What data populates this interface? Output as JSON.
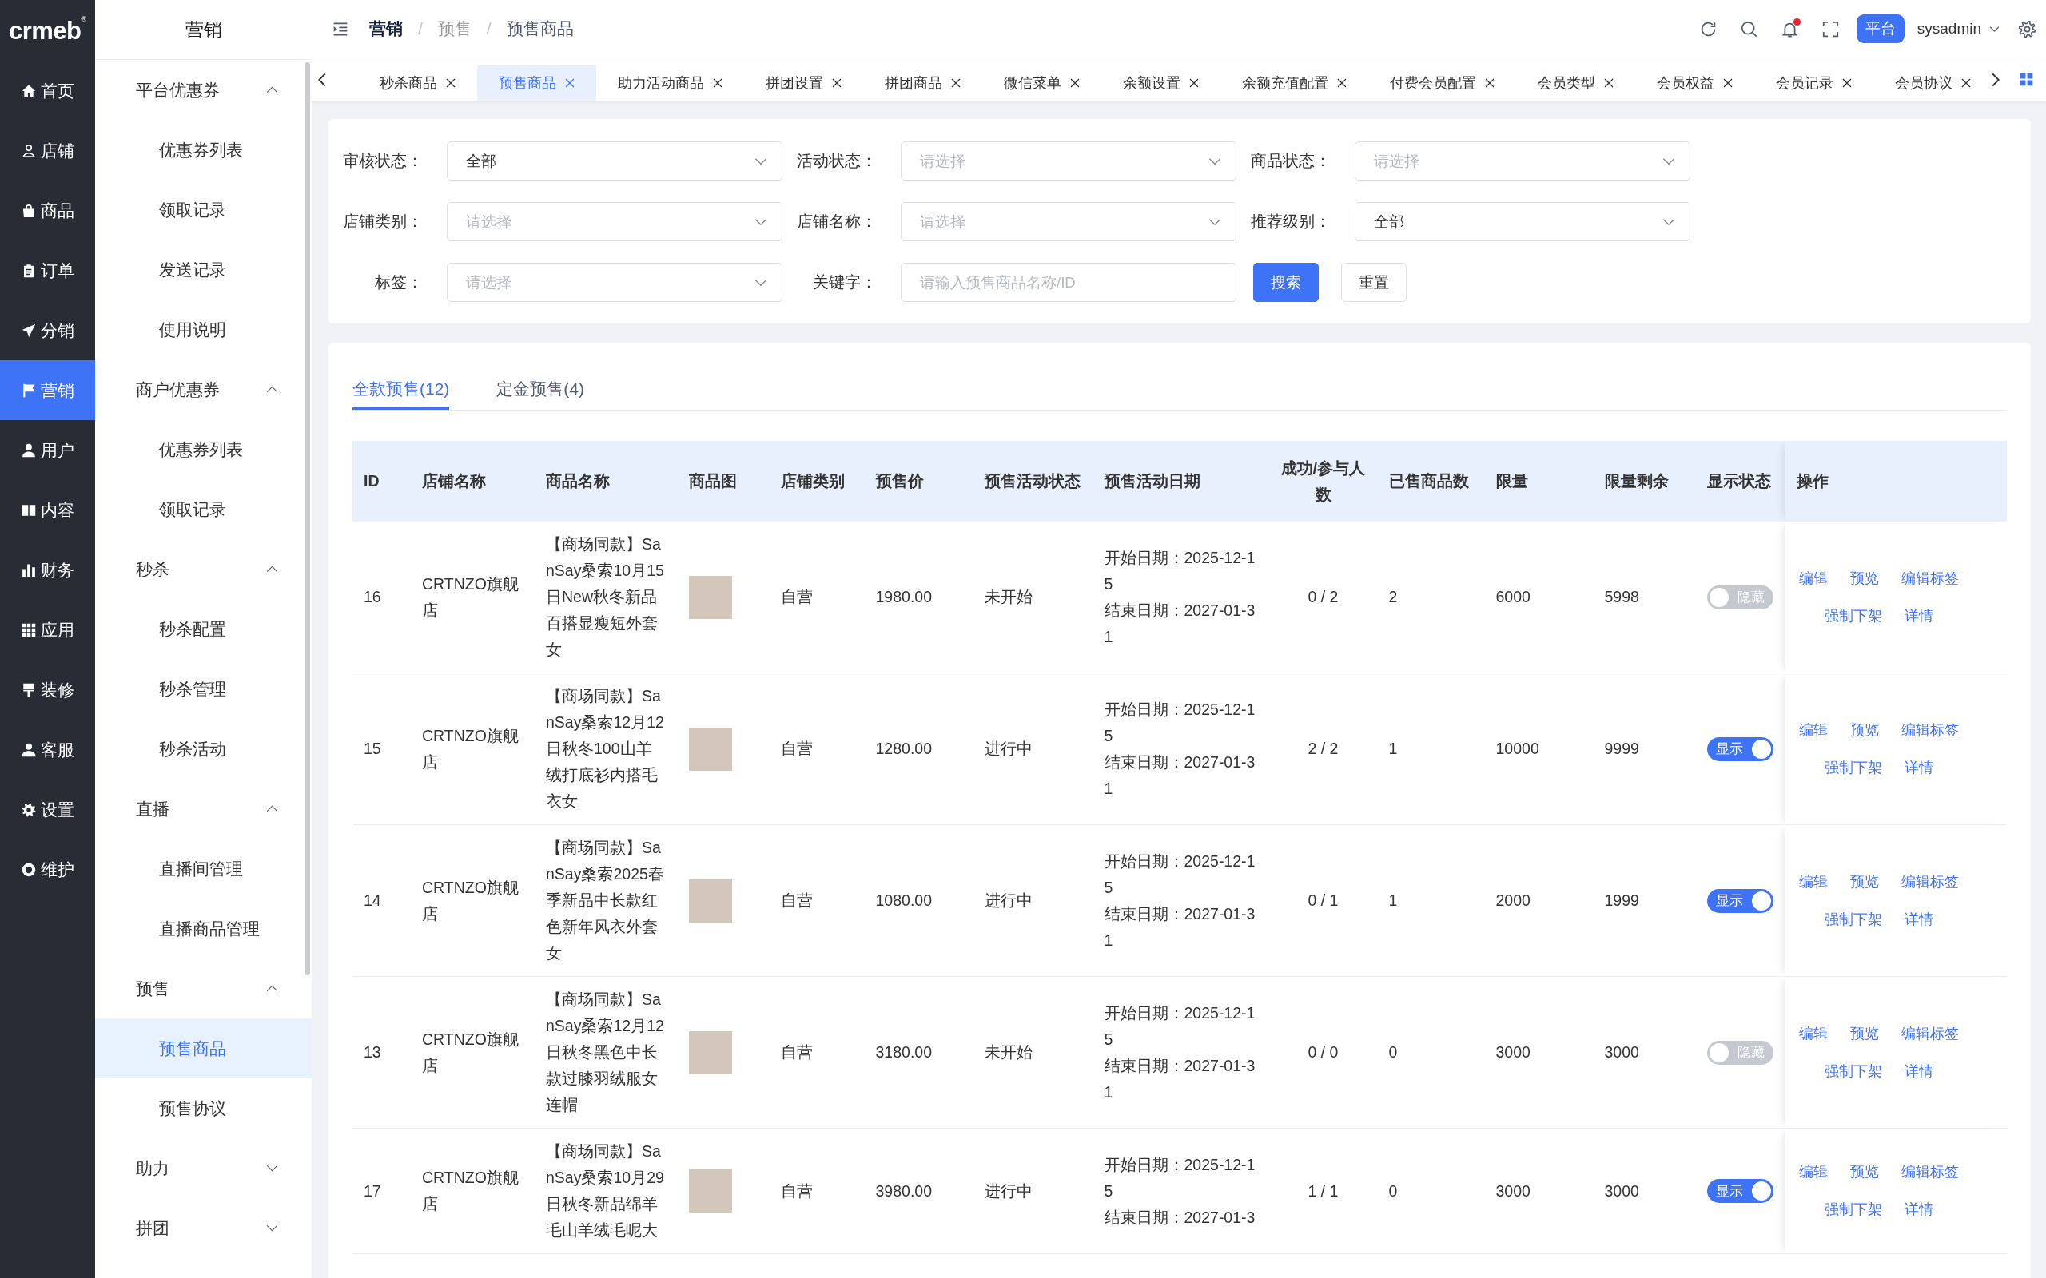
{
  "logo": {
    "text": "crmeb",
    "mark": "®"
  },
  "main_nav": {
    "items": [
      {
        "label": "首页",
        "selected": false
      },
      {
        "label": "店铺",
        "selected": false
      },
      {
        "label": "商品",
        "selected": false
      },
      {
        "label": "订单",
        "selected": false
      },
      {
        "label": "分销",
        "selected": false
      },
      {
        "label": "营销",
        "selected": true
      },
      {
        "label": "用户",
        "selected": false
      },
      {
        "label": "内容",
        "selected": false
      },
      {
        "label": "财务",
        "selected": false
      },
      {
        "label": "应用",
        "selected": false
      },
      {
        "label": "装修",
        "selected": false
      },
      {
        "label": "客服",
        "selected": false
      },
      {
        "label": "设置",
        "selected": false
      },
      {
        "label": "维护",
        "selected": false
      }
    ]
  },
  "sub_nav": {
    "title": "营销",
    "groups": [
      {
        "label": "平台优惠券",
        "expanded": true,
        "children": [
          {
            "label": "优惠券列表",
            "selected": false
          },
          {
            "label": "领取记录",
            "selected": false
          },
          {
            "label": "发送记录",
            "selected": false
          },
          {
            "label": "使用说明",
            "selected": false
          }
        ]
      },
      {
        "label": "商户优惠券",
        "expanded": true,
        "children": [
          {
            "label": "优惠券列表",
            "selected": false
          },
          {
            "label": "领取记录",
            "selected": false
          }
        ]
      },
      {
        "label": "秒杀",
        "expanded": true,
        "children": [
          {
            "label": "秒杀配置",
            "selected": false
          },
          {
            "label": "秒杀管理",
            "selected": false
          },
          {
            "label": "秒杀活动",
            "selected": false
          }
        ]
      },
      {
        "label": "直播",
        "expanded": true,
        "children": [
          {
            "label": "直播间管理",
            "selected": false
          },
          {
            "label": "直播商品管理",
            "selected": false
          }
        ]
      },
      {
        "label": "预售",
        "expanded": true,
        "children": [
          {
            "label": "预售商品",
            "selected": true
          },
          {
            "label": "预售协议",
            "selected": false
          }
        ]
      },
      {
        "label": "助力",
        "expanded": false
      },
      {
        "label": "拼团",
        "expanded": false
      }
    ]
  },
  "header": {
    "breadcrumb": [
      {
        "label": "营销"
      },
      {
        "separator": "/",
        "label": "预售"
      },
      {
        "separator": "/",
        "label": "预售商品"
      }
    ],
    "notification_dot": true,
    "badge": "平台",
    "user": "sysadmin"
  },
  "page_tabs": [
    {
      "label": "秒杀商品",
      "selected": false
    },
    {
      "label": "预售商品",
      "selected": true
    },
    {
      "label": "助力活动商品",
      "selected": false
    },
    {
      "label": "拼团设置",
      "selected": false
    },
    {
      "label": "拼团商品",
      "selected": false
    },
    {
      "label": "微信菜单",
      "selected": false
    },
    {
      "label": "余额设置",
      "selected": false
    },
    {
      "label": "余额充值配置",
      "selected": false
    },
    {
      "label": "付费会员配置",
      "selected": false
    },
    {
      "label": "会员类型",
      "selected": false
    },
    {
      "label": "会员权益",
      "selected": false
    },
    {
      "label": "会员记录",
      "selected": false
    },
    {
      "label": "会员协议",
      "selected": false
    }
  ],
  "filters": [
    {
      "label": "审核状态：",
      "kind": "select",
      "value": "全部"
    },
    {
      "label": "活动状态：",
      "kind": "select",
      "placeholder": "请选择"
    },
    {
      "label": "商品状态：",
      "kind": "select",
      "placeholder": "请选择"
    },
    {
      "label": "店铺类别：",
      "kind": "select",
      "placeholder": "请选择"
    },
    {
      "label": "店铺名称：",
      "kind": "select",
      "placeholder": "请选择"
    },
    {
      "label": "推荐级别：",
      "kind": "select",
      "value": "全部"
    },
    {
      "label": "标签：",
      "kind": "select",
      "placeholder": "请选择"
    },
    {
      "label": "关键字：",
      "kind": "input",
      "placeholder": "请输入预售商品名称/ID"
    }
  ],
  "filter_buttons": [
    {
      "label": "搜索",
      "kind": "primary"
    },
    {
      "label": "重置",
      "kind": "plain"
    }
  ],
  "list_tabs": [
    {
      "label": "全款预售(12)",
      "selected": true
    },
    {
      "label": "定金预售(4)",
      "selected": false
    }
  ],
  "table": {
    "columns": [
      "ID",
      "店铺名称",
      "商品名称",
      "商品图",
      "店铺类别",
      "预售价",
      "预售活动状态",
      "预售活动日期",
      "成功/参与人数",
      "已售商品数",
      "限量",
      "限量剩余",
      "显示状态",
      "操作"
    ],
    "rows": [
      {
        "id": "16",
        "store": "CRTNZO旗舰店",
        "product": "【商场同款】SanSay桑索10月15日New秋冬新品百搭显瘦短外套女",
        "store_type": "自营",
        "price": "1980.00",
        "status": "未开始",
        "start_date": "开始日期：2025-12-15",
        "end_date": "结束日期：2027-01-31",
        "participants": "0 / 2",
        "sold": "2",
        "limit": "6000",
        "remaining": "5998",
        "display": {
          "on": false,
          "label": "隐藏"
        },
        "actions": [
          "编辑",
          "预览",
          "编辑标签",
          "强制下架",
          "详情"
        ]
      },
      {
        "id": "15",
        "store": "CRTNZO旗舰店",
        "product": "【商场同款】SanSay桑索12月12日秋冬100山羊绒打底衫内搭毛衣女",
        "store_type": "自营",
        "price": "1280.00",
        "status": "进行中",
        "start_date": "开始日期：2025-12-15",
        "end_date": "结束日期：2027-01-31",
        "participants": "2 / 2",
        "sold": "1",
        "limit": "10000",
        "remaining": "9999",
        "display": {
          "on": true,
          "label": "显示"
        },
        "actions": [
          "编辑",
          "预览",
          "编辑标签",
          "强制下架",
          "详情"
        ]
      },
      {
        "id": "14",
        "store": "CRTNZO旗舰店",
        "product": "【商场同款】SanSay桑索2025春季新品中长款红色新年风衣外套女",
        "store_type": "自营",
        "price": "1080.00",
        "status": "进行中",
        "start_date": "开始日期：2025-12-15",
        "end_date": "结束日期：2027-01-31",
        "participants": "0 / 1",
        "sold": "1",
        "limit": "2000",
        "remaining": "1999",
        "display": {
          "on": true,
          "label": "显示"
        },
        "actions": [
          "编辑",
          "预览",
          "编辑标签",
          "强制下架",
          "详情"
        ]
      },
      {
        "id": "13",
        "store": "CRTNZO旗舰店",
        "product": "【商场同款】SanSay桑索12月12日秋冬黑色中长款过膝羽绒服女连帽",
        "store_type": "自营",
        "price": "3180.00",
        "status": "未开始",
        "start_date": "开始日期：2025-12-15",
        "end_date": "结束日期：2027-01-31",
        "participants": "0 / 0",
        "sold": "0",
        "limit": "3000",
        "remaining": "3000",
        "display": {
          "on": false,
          "label": "隐藏"
        },
        "actions": [
          "编辑",
          "预览",
          "编辑标签",
          "强制下架",
          "详情"
        ]
      },
      {
        "id": "17",
        "store": "CRTNZO旗舰店",
        "product": "【商场同款】SanSay桑索10月29日秋冬新品绵羊毛山羊绒毛呢大",
        "store_type": "自营",
        "price": "3980.00",
        "status": "进行中",
        "start_date": "开始日期：2025-12-15",
        "end_date": "结束日期：2027-01-3",
        "participants": "1 / 1",
        "sold": "0",
        "limit": "3000",
        "remaining": "3000",
        "display": {
          "on": true,
          "label": "显示"
        },
        "actions": [
          "编辑",
          "预览",
          "编辑标签",
          "强制下架",
          "详情"
        ]
      }
    ]
  }
}
